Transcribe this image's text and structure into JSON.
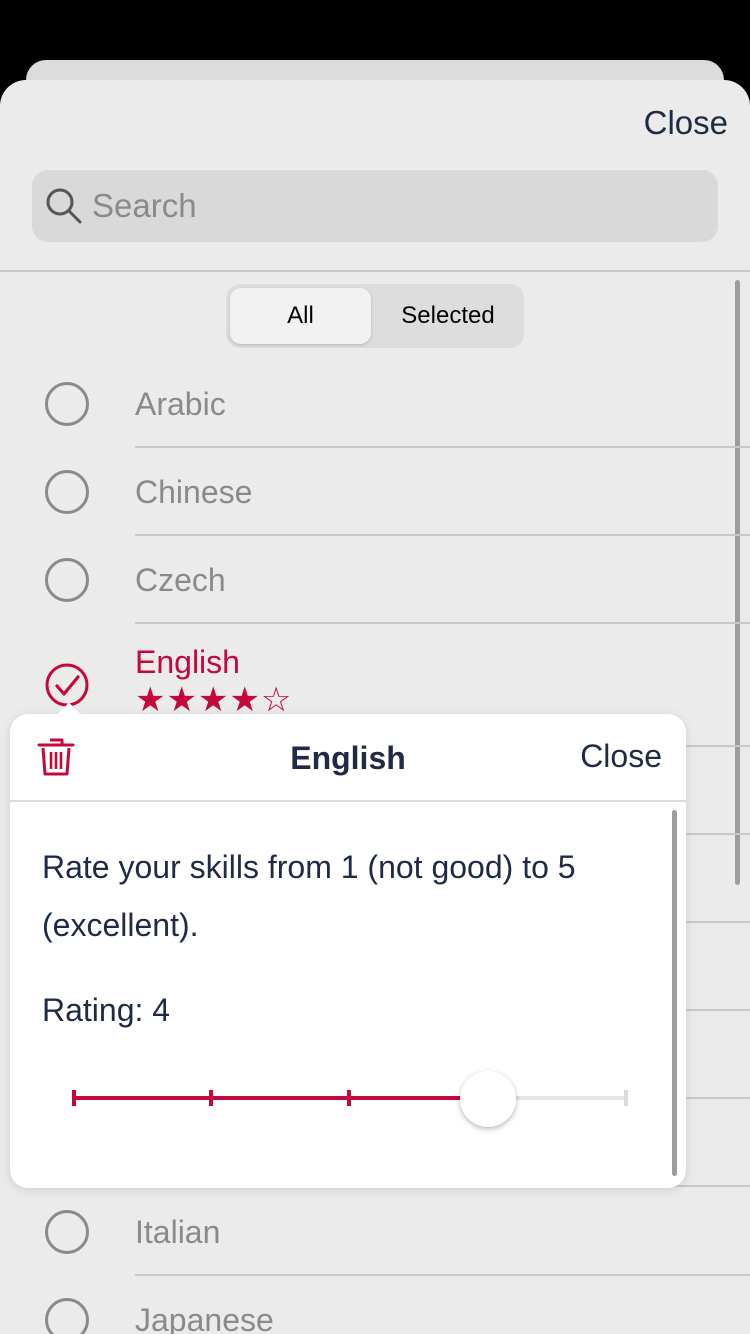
{
  "sheet": {
    "close_label": "Close"
  },
  "search": {
    "placeholder": "Search",
    "icon": "search-icon"
  },
  "segmented_control": {
    "options": [
      "All",
      "Selected"
    ],
    "selected": "All"
  },
  "languages": [
    {
      "name": "Arabic",
      "selected": false
    },
    {
      "name": "Chinese",
      "selected": false
    },
    {
      "name": "Czech",
      "selected": false
    },
    {
      "name": "English",
      "selected": true,
      "stars": "★★★★☆",
      "rating": 4
    },
    {
      "name": "Italian",
      "selected": false
    },
    {
      "name": "Japanese",
      "selected": false
    }
  ],
  "modal": {
    "title": "English",
    "close_label": "Close",
    "delete_icon": "trash-icon",
    "instructions": "Rate your skills from 1 (not good) to 5 (excellent).",
    "rating_label": "Rating: 4",
    "slider": {
      "min": 1,
      "max": 5,
      "value": 4
    }
  },
  "colors": {
    "accent": "#c4083c",
    "text_primary": "#1f2a44",
    "text_secondary": "#8a8a8e",
    "sheet_background": "#ebebeb"
  }
}
